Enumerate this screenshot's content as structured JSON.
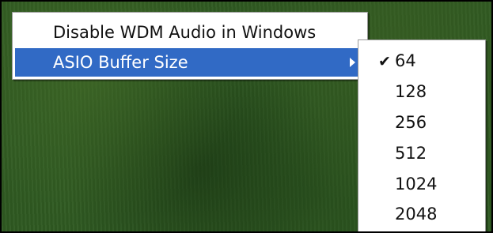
{
  "menu": {
    "items": [
      {
        "label": "Disable WDM Audio in Windows"
      },
      {
        "label": "ASIO Buffer Size",
        "submenu_arrow": "chevron-right-icon",
        "highlighted": true
      }
    ]
  },
  "submenu": {
    "checked_value": "64",
    "check_glyph": "✔",
    "items": [
      {
        "label": "64"
      },
      {
        "label": "128"
      },
      {
        "label": "256"
      },
      {
        "label": "512"
      },
      {
        "label": "1024"
      },
      {
        "label": "2048"
      }
    ]
  },
  "colors": {
    "highlight": "#316ac5",
    "menu_bg": "#ffffff",
    "backdrop": "#2f5a22"
  }
}
